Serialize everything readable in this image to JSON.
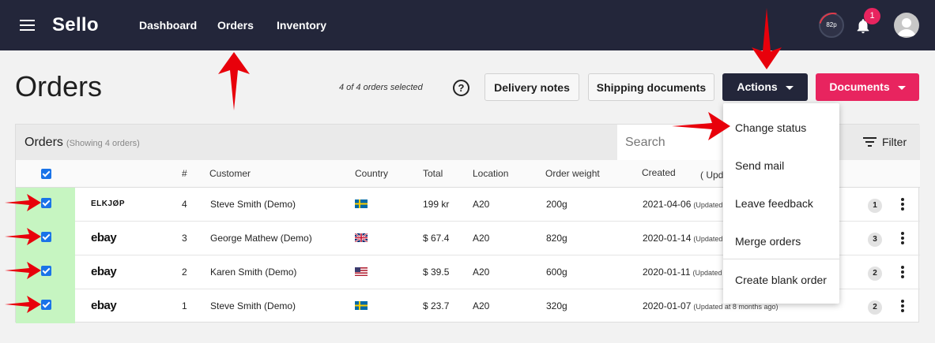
{
  "nav": {
    "brand": "Sello",
    "items": [
      "Dashboard",
      "Orders",
      "Inventory"
    ],
    "points": "82p",
    "notifications": "1"
  },
  "page": {
    "title": "Orders",
    "selected_text": "4 of 4 orders selected",
    "help": "?",
    "buttons": {
      "delivery": "Delivery notes",
      "shipping": "Shipping documents",
      "actions": "Actions",
      "documents": "Documents"
    }
  },
  "panel": {
    "title": "Orders",
    "subtitle": "(Showing 4 orders)",
    "search_placeholder": "Search",
    "filter": "Filter"
  },
  "columns": [
    "#",
    "Customer",
    "Country",
    "Total",
    "Location",
    "Order weight",
    "Created",
    "( Upd"
  ],
  "rows": [
    {
      "logo": "ELKJØP",
      "num": "4",
      "customer": "Steve Smith (Demo)",
      "country": "se",
      "total": "199 kr",
      "location": "A20",
      "weight": "200g",
      "created": "2021-04-06",
      "updated": "(Updated",
      "count": "1"
    },
    {
      "logo": "ebay",
      "num": "3",
      "customer": "George Mathew (Demo)",
      "country": "gb",
      "total": "$ 67.4",
      "location": "A20",
      "weight": "820g",
      "created": "2020-01-14",
      "updated": "(Updated",
      "count": "3"
    },
    {
      "logo": "ebay",
      "num": "2",
      "customer": "Karen Smith (Demo)",
      "country": "us",
      "total": "$ 39.5",
      "location": "A20",
      "weight": "600g",
      "created": "2020-01-11",
      "updated": "(Updated",
      "count": "2"
    },
    {
      "logo": "ebay",
      "num": "1",
      "customer": "Steve Smith (Demo)",
      "country": "se",
      "total": "$ 23.7",
      "location": "A20",
      "weight": "320g",
      "created": "2020-01-07",
      "updated": "(Updated at 8 months ago)",
      "count": "2"
    }
  ],
  "actions_menu": [
    "Change status",
    "Send mail",
    "Leave feedback",
    "Merge orders",
    "Create blank order"
  ],
  "colors": {
    "topbar": "#23263a",
    "accent_pink": "#e8245f",
    "selected_row": "#c6f5c1",
    "annotation_red": "#e8000b"
  }
}
